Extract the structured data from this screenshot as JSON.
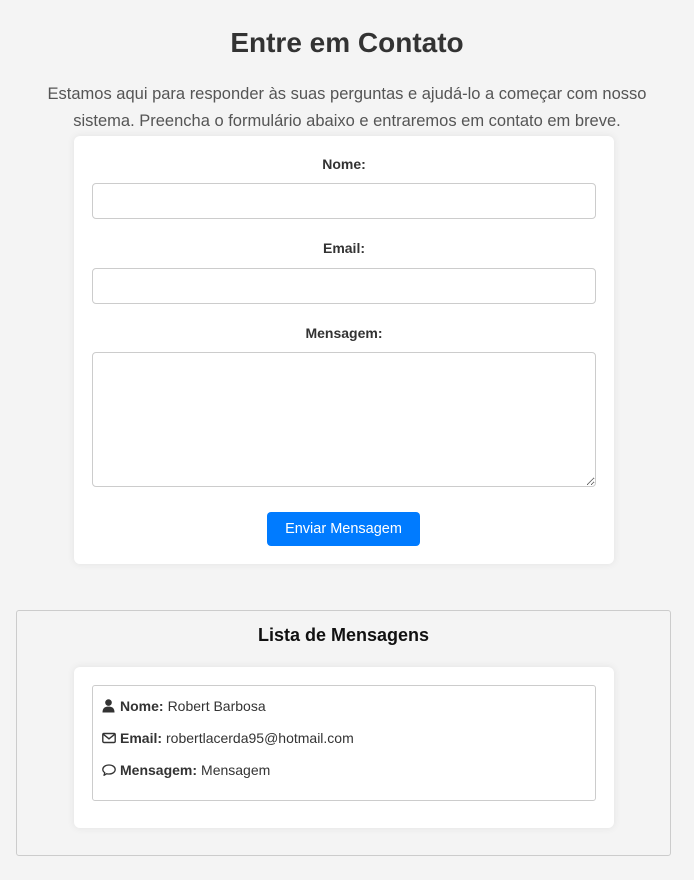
{
  "header": {
    "title": "Entre em Contato",
    "intro": "Estamos aqui para responder às suas perguntas e ajudá-lo a começar com nosso sistema. Preencha o formulário abaixo e entraremos em contato em breve."
  },
  "form": {
    "name_label": "Nome:",
    "name_value": "",
    "email_label": "Email:",
    "email_value": "",
    "message_label": "Mensagem:",
    "message_value": "",
    "submit_label": "Enviar Mensagem",
    "accent_color": "#007bff"
  },
  "messages": {
    "title": "Lista de Mensagens",
    "items": [
      {
        "name_label": "Nome:",
        "name": "Robert Barbosa",
        "name_icon": "user-icon",
        "email_label": "Email:",
        "email": "robertlacerda95@hotmail.com",
        "email_icon": "envelope-icon",
        "message_label": "Mensagem:",
        "message": "Mensagem",
        "message_icon": "comment-icon"
      }
    ]
  }
}
